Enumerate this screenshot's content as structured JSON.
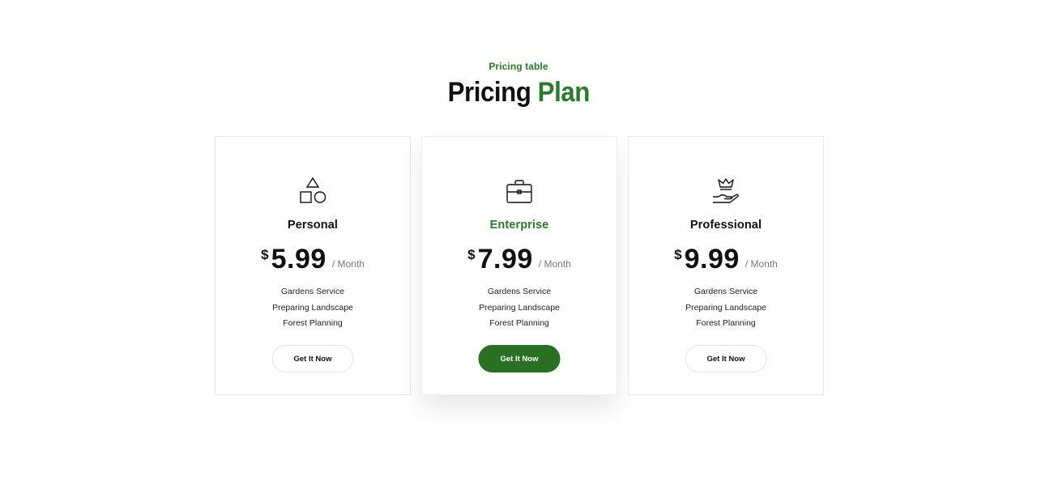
{
  "section": {
    "eyebrow": "Pricing table",
    "title_main": "Pricing",
    "title_accent": "Plan"
  },
  "colors": {
    "accent": "#2a7a2c",
    "button_primary": "#2a7023",
    "text": "#111111",
    "muted": "#777777"
  },
  "plans": [
    {
      "name": "Personal",
      "icon": "shapes-icon",
      "currency": "$",
      "price": "5.99",
      "period": "/ Month",
      "features": [
        "Gardens Service",
        "Preparing Landscape",
        "Forest Planning"
      ],
      "cta": "Get It Now",
      "featured": false
    },
    {
      "name": "Enterprise",
      "icon": "briefcase-icon",
      "currency": "$",
      "price": "7.99",
      "period": "/ Month",
      "features": [
        "Gardens Service",
        "Preparing Landscape",
        "Forest Planning"
      ],
      "cta": "Get It Now",
      "featured": true
    },
    {
      "name": "Professional",
      "icon": "crown-hand-icon",
      "currency": "$",
      "price": "9.99",
      "period": "/ Month",
      "features": [
        "Gardens Service",
        "Preparing Landscape",
        "Forest Planning"
      ],
      "cta": "Get It Now",
      "featured": false
    }
  ]
}
